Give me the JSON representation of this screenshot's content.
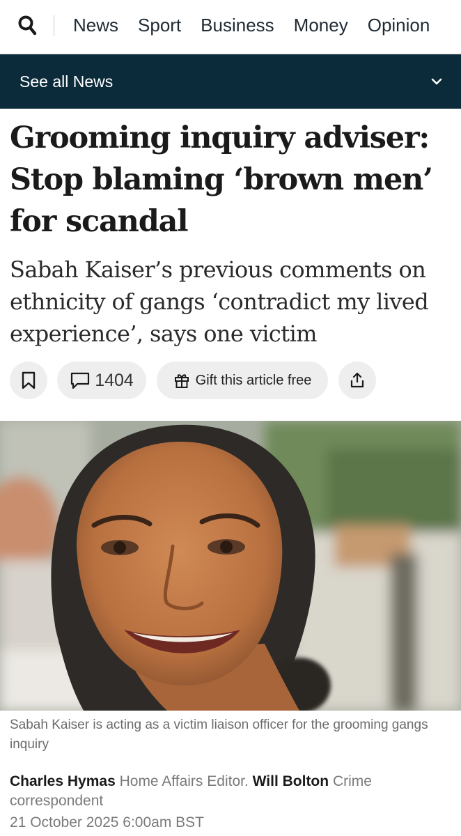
{
  "nav": {
    "items": [
      "News",
      "Sport",
      "Business",
      "Money",
      "Opinion"
    ]
  },
  "section_bar": {
    "label": "See all News"
  },
  "article": {
    "headline": "Grooming inquiry adviser: Stop blaming ‘brown men’ for scandal",
    "standfirst": "Sabah Kaiser’s previous comments on ethnicity of gangs ‘contradict my lived experience’, says one victim",
    "comment_count": "1404",
    "gift_label": "Gift this article free",
    "caption": "Sabah Kaiser is acting as a victim liaison officer for the grooming gangs inquiry",
    "byline": {
      "author1": "Charles Hymas",
      "role1": "Home Affairs Editor.",
      "author2": "Will Bolton",
      "role2": "Crime correspondent"
    },
    "date": "21 October 2025 6:00am BST"
  },
  "icons": {
    "search": "search-icon",
    "chevron": "chevron-down-icon",
    "bookmark": "bookmark-icon",
    "comment": "comment-icon",
    "gift": "gift-icon",
    "share": "share-icon"
  },
  "colors": {
    "section_bar": "#0b2a3a",
    "button_bg": "#eeeeee",
    "caption_text": "#6b6b6b"
  }
}
